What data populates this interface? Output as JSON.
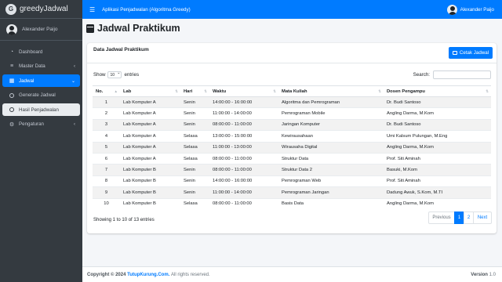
{
  "sidebar": {
    "brand": "greedyJadwal",
    "user": "Alexander Paijo",
    "items": [
      {
        "label": "Dashboard",
        "icon": "dashboard-icon"
      },
      {
        "label": "Master Data",
        "icon": "database-icon"
      },
      {
        "label": "Jadwal",
        "icon": "calendar-icon"
      },
      {
        "label": "Generate Jadwal",
        "icon": "circle-icon"
      },
      {
        "label": "Hasil Penjadwalan",
        "icon": "circle-icon"
      },
      {
        "label": "Pengaturan",
        "icon": "gear-icon"
      }
    ]
  },
  "topbar": {
    "app_title": "Aplikasi Penjadwalan (Algoritma Greedy)",
    "user": "Alexander Paijo"
  },
  "page": {
    "title": "Jadwal Praktikum"
  },
  "card": {
    "title": "Data Jadwal Praktikum",
    "print_label": "Cetak Jadwal",
    "show_label": "Show",
    "entries_value": "10",
    "entries_label": "entries",
    "search_label": "Search:",
    "search_value": ""
  },
  "table": {
    "headers": [
      "No.",
      "Lab",
      "Hari",
      "Waktu",
      "Mata Kuliah",
      "Dosen Pengampu"
    ],
    "rows": [
      [
        "1",
        "Lab Komputer A",
        "Senin",
        "14:00:00 - 16:00:00",
        "Algoritma dan Pemrograman",
        "Dr. Budi Santoso"
      ],
      [
        "2",
        "Lab Komputer A",
        "Senin",
        "11:00:00 - 14:00:00",
        "Pemrograman Mobile",
        "Angling Darma, M.Kom"
      ],
      [
        "3",
        "Lab Komputer A",
        "Senin",
        "08:00:00 - 11:00:00",
        "Jaringan Komputer",
        "Dr. Budi Santoso"
      ],
      [
        "4",
        "Lab Komputer A",
        "Selasa",
        "13:00:00 - 15:00:00",
        "Kewirausahaan",
        "Umi Kalsum Pulungan, M.Eng"
      ],
      [
        "5",
        "Lab Komputer A",
        "Selasa",
        "11:00:00 - 13:00:00",
        "Wirausaha Digital",
        "Angling Darma, M.Kom"
      ],
      [
        "6",
        "Lab Komputer A",
        "Selasa",
        "08:00:00 - 11:00:00",
        "Struktur Data",
        "Prof. Siti Aminah"
      ],
      [
        "7",
        "Lab Komputer B",
        "Senin",
        "08:00:00 - 11:00:00",
        "Struktur Data 2",
        "Basuki, M.Kom"
      ],
      [
        "8",
        "Lab Komputer B",
        "Senin",
        "14:00:00 - 16:00:00",
        "Pemrograman Web",
        "Prof. Siti Aminah"
      ],
      [
        "9",
        "Lab Komputer B",
        "Senin",
        "11:00:00 - 14:00:00",
        "Pemrograman Jaringan",
        "Dadung Awuk, S.Kom, M.TI"
      ],
      [
        "10",
        "Lab Komputer B",
        "Selasa",
        "08:00:00 - 11:00:00",
        "Basis Data",
        "Angling Darma, M.Kom"
      ]
    ]
  },
  "pagination": {
    "info": "Showing 1 to 10 of 13 entries",
    "previous": "Previous",
    "pages": [
      "1",
      "2"
    ],
    "next": "Next"
  },
  "footer": {
    "copyright": "Copyright © 2024",
    "brand": "TutupKurung.Com.",
    "rights": "All rights reserved.",
    "version_label": "Version",
    "version": "1.0"
  },
  "colors": {
    "primary": "#007bff",
    "sidebar": "#343a40"
  }
}
